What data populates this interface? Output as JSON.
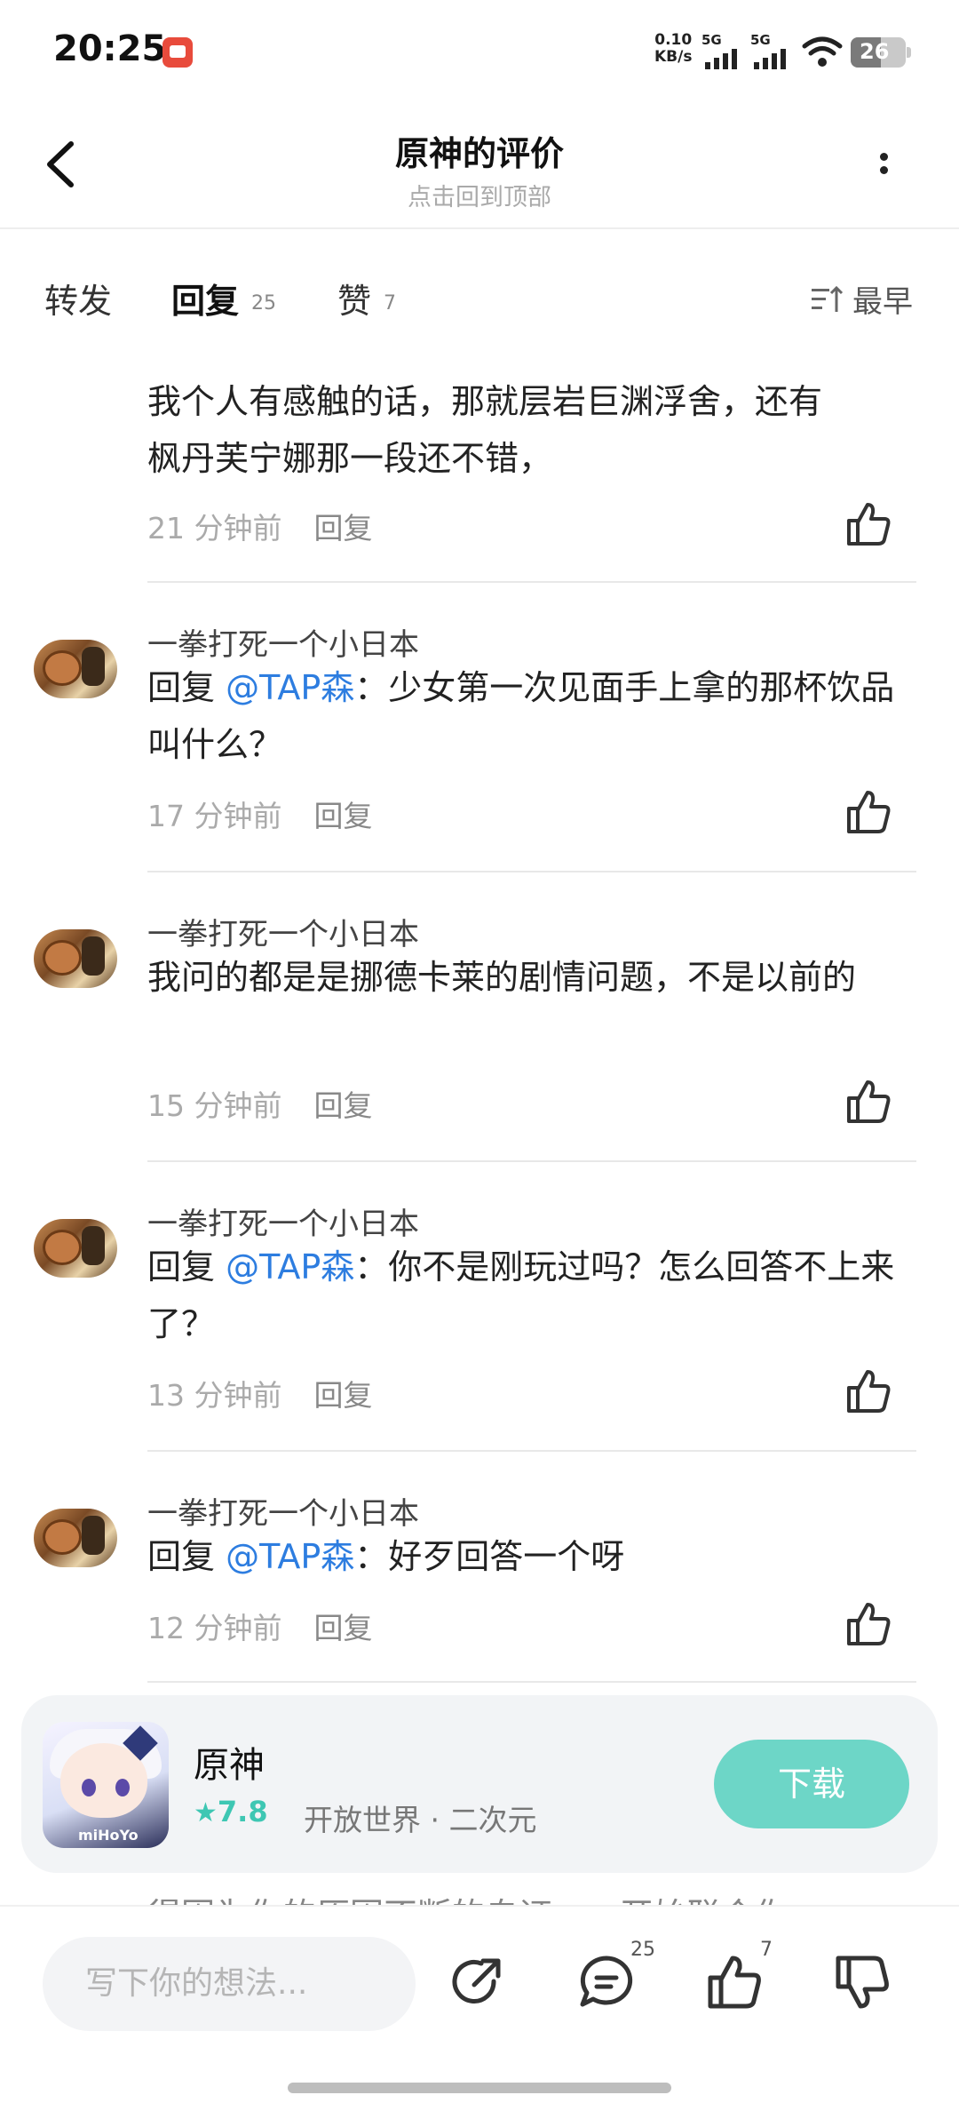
{
  "status_bar": {
    "time": "20:25",
    "net_speed_value": "0.10",
    "net_speed_unit": "KB/s",
    "signal1_label": "5G",
    "signal2_label": "5G",
    "battery": "26"
  },
  "header": {
    "title": "原神的评价",
    "subtitle": "点击回到顶部"
  },
  "tabs": {
    "repost_label": "转发",
    "reply_label": "回复",
    "reply_count": "25",
    "like_label": "赞",
    "like_count": "7",
    "sort_label": "最早"
  },
  "replies": [
    {
      "body_line1": "我个人有感触的话，那就层岩巨渊浮舍，还有",
      "body_line2": "枫丹芙宁娜那一段还不错，",
      "time": "21 分钟前",
      "reply_label": "回复"
    },
    {
      "author": "一拳打死一个小日本",
      "reply_prefix": "回复 ",
      "mention": "@TAP森",
      "text": "：少女第一次见面手上拿的那杯饮品叫什么？",
      "time": "17 分钟前",
      "reply_label": "回复"
    },
    {
      "author": "一拳打死一个小日本",
      "text": "我问的都是是挪德卡莱的剧情问题，不是以前的",
      "time": "15 分钟前",
      "reply_label": "回复"
    },
    {
      "author": "一拳打死一个小日本",
      "reply_prefix": "回复 ",
      "mention": "@TAP森",
      "text": "：你不是刚玩过吗？怎么回答不上来了？",
      "time": "13 分钟前",
      "reply_label": "回复"
    },
    {
      "author": "一拳打死一个小日本",
      "reply_prefix": "回复 ",
      "mention": "@TAP森",
      "text": "：好歹回答一个呀",
      "time": "12 分钟前",
      "reply_label": "回复"
    }
  ],
  "app_card": {
    "name": "原神",
    "rating": "7.8",
    "tags": "开放世界 · 二次元",
    "download_label": "下载",
    "icon_badge": "miHoYo"
  },
  "peek_text": "得因为你的原因不断的自证……开始联合你",
  "bottom_bar": {
    "input_placeholder": "写下你的想法...",
    "comment_count": "25",
    "like_count": "7"
  },
  "colors": {
    "accent": "#3ec7b3",
    "download_bg": "#6dd6c7",
    "mention": "#2d7de0"
  }
}
